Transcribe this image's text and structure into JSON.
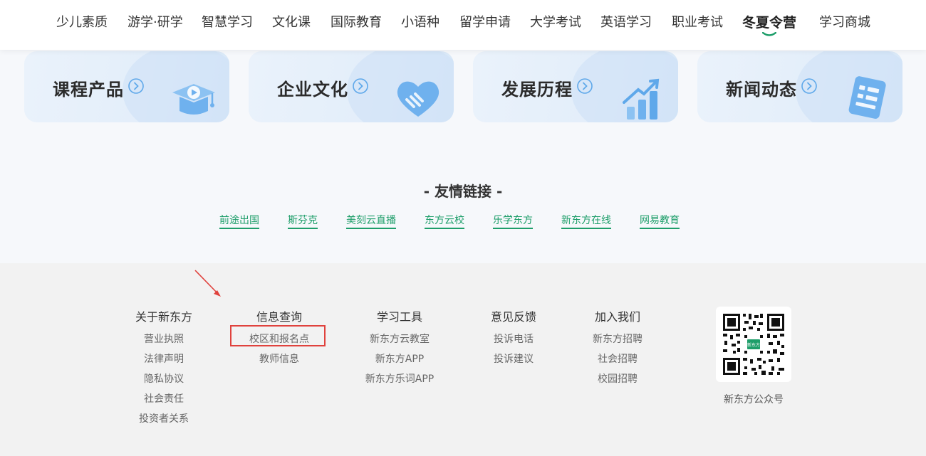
{
  "nav": {
    "items": [
      "少儿素质",
      "游学·研学",
      "智慧学习",
      "文化课",
      "国际教育",
      "小语种",
      "留学申请",
      "大学考试",
      "英语学习",
      "职业考试",
      "冬夏令营",
      "学习商城"
    ],
    "active_index": 10
  },
  "cards": [
    {
      "title": "课程产品",
      "icon": "graduation-cap-play-icon"
    },
    {
      "title": "企业文化",
      "icon": "heart-icon"
    },
    {
      "title": "发展历程",
      "icon": "growth-chart-icon"
    },
    {
      "title": "新闻动态",
      "icon": "news-document-icon"
    }
  ],
  "friends": {
    "title": "- 友情链接 -",
    "links": [
      "前途出国",
      "斯芬克",
      "美刻云直播",
      "东方云校",
      "乐学东方",
      "新东方在线",
      "网易教育"
    ]
  },
  "footer": {
    "columns": [
      {
        "heading": "关于新东方",
        "links": [
          "营业执照",
          "法律声明",
          "隐私协议",
          "社会责任",
          "投资者关系"
        ]
      },
      {
        "heading": "信息查询",
        "links": [
          "校区和报名点",
          "教师信息"
        ]
      },
      {
        "heading": "学习工具",
        "links": [
          "新东方云教室",
          "新东方APP",
          "新东方乐词APP"
        ]
      },
      {
        "heading": "意见反馈",
        "links": [
          "投诉电话",
          "投诉建议"
        ]
      },
      {
        "heading": "加入我们",
        "links": [
          "新东方招聘",
          "社会招聘",
          "校园招聘"
        ]
      }
    ],
    "qr": {
      "caption": "新东方公众号",
      "logo_text": "新东方"
    }
  },
  "colors": {
    "accent": "#1e9e6a",
    "highlight": "#e0423d",
    "card_icon": "#5fa8ea"
  }
}
